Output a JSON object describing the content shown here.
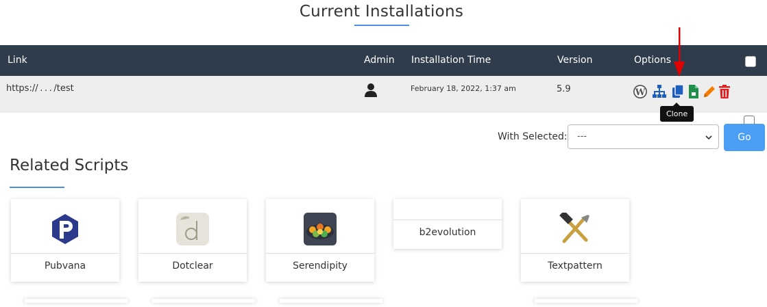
{
  "page_title": "Current Installations",
  "table": {
    "headers": {
      "link": "Link",
      "admin": "Admin",
      "installation_time": "Installation Time",
      "version": "Version",
      "options": "Options"
    },
    "rows": [
      {
        "link": "https:// . . . /test",
        "installation_time": "February 18, 2022, 1:37 am",
        "version": "5.9"
      }
    ],
    "options_icons": [
      "wordpress-icon",
      "staging-icon",
      "clone-icon",
      "backup-icon",
      "edit-icon",
      "delete-icon"
    ]
  },
  "tooltip": "Clone",
  "bulk": {
    "label": "With Selected:",
    "selected": "---",
    "go_label": "Go"
  },
  "related": {
    "title": "Related Scripts",
    "scripts": [
      {
        "name": "Pubvana",
        "icon": "pubvana-logo"
      },
      {
        "name": "Dotclear",
        "icon": "dotclear-logo"
      },
      {
        "name": "Serendipity",
        "icon": "serendipity-logo"
      },
      {
        "name": "b2evolution",
        "icon": "b2evolution-logo"
      },
      {
        "name": "Textpattern",
        "icon": "textpattern-logo"
      }
    ]
  },
  "colors": {
    "header_bg": "#2f3c4c",
    "accent": "#4a90e2",
    "go_button": "#4a9ff5",
    "delete": "#e02020",
    "edit": "#f57c00",
    "arrow": "#e00000"
  }
}
